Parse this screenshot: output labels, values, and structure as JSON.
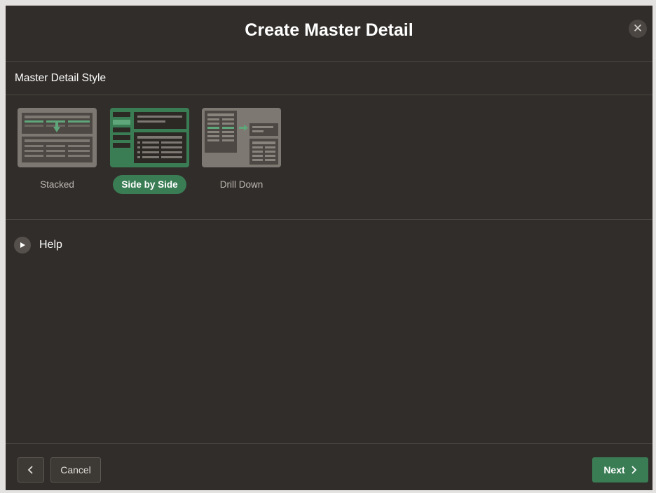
{
  "dialog": {
    "title": "Create Master Detail",
    "close_icon": "close-icon"
  },
  "section": {
    "title": "Master Detail Style"
  },
  "styles": [
    {
      "label": "Stacked",
      "selected": false
    },
    {
      "label": "Side by Side",
      "selected": true
    },
    {
      "label": "Drill Down",
      "selected": false
    }
  ],
  "help": {
    "label": "Help",
    "icon": "play-triangle-icon"
  },
  "footer": {
    "back_icon": "chevron-left-icon",
    "cancel_label": "Cancel",
    "next_label": "Next",
    "next_icon": "chevron-right-icon"
  },
  "colors": {
    "background": "#312d2a",
    "accent": "#3a7d55"
  }
}
